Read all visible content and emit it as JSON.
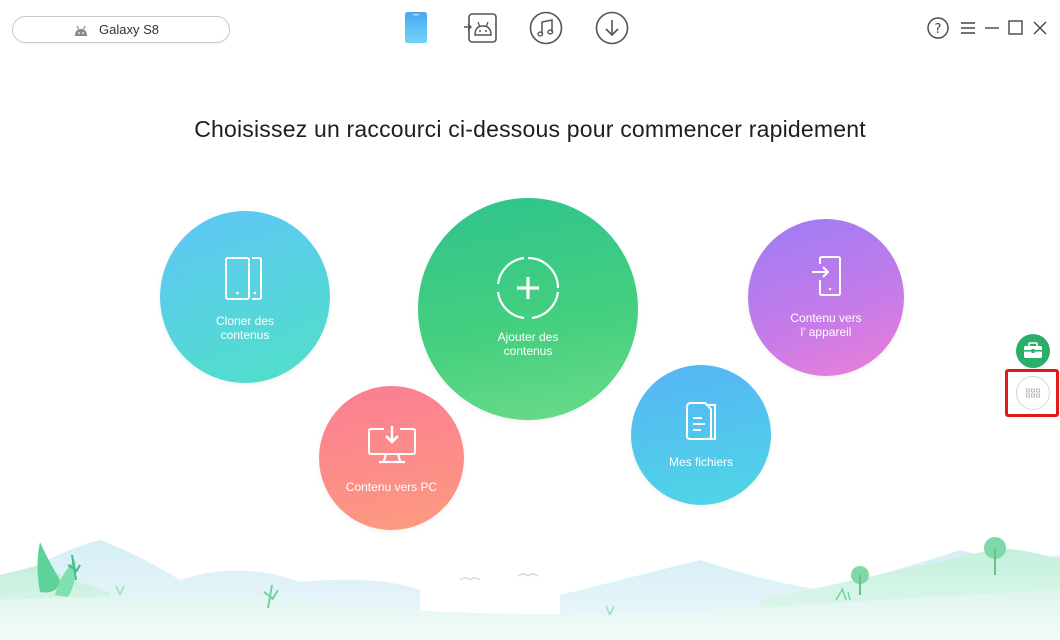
{
  "device": {
    "name": "Galaxy S8",
    "icon": "android-icon"
  },
  "nav": [
    {
      "name": "device-manager-icon",
      "active": true
    },
    {
      "name": "android-mover-icon",
      "active": false
    },
    {
      "name": "music-icon",
      "active": false
    },
    {
      "name": "download-icon",
      "active": false
    }
  ],
  "window_controls": [
    "help-icon",
    "menu-icon",
    "minimize-icon",
    "maximize-icon",
    "close-icon"
  ],
  "headline": "Choisissez un raccourci ci-dessous pour commencer rapidement",
  "shortcuts": {
    "clone": {
      "label": "Cloner des\ncontenus",
      "color": "#4fd8d0"
    },
    "add": {
      "label": "Ajouter des\ncontenus",
      "color": "#3cc985"
    },
    "to_device": {
      "label": "Contenu vers\nl’ appareil",
      "color": "#c77be8"
    },
    "files": {
      "label": "Mes fichiers",
      "color": "#52c3ee"
    },
    "to_pc": {
      "label": "Contenu vers PC",
      "color": "#fc8b89"
    }
  },
  "side": {
    "toolkit_color": "#2aae6a",
    "apps_highlight_color": "#e01919"
  }
}
